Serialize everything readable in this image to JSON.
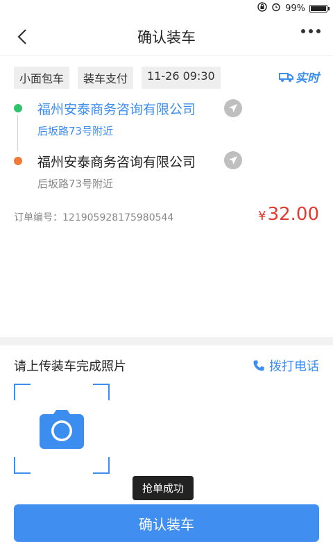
{
  "status_bar": {
    "battery_text": "99%",
    "battery_level": 0.99
  },
  "header": {
    "title": "确认装车"
  },
  "order": {
    "tags": [
      "小面包车",
      "装车支付",
      "11-26 09:30"
    ],
    "realtime_label": "实时",
    "from": {
      "name": "福州安泰商务咨询有限公司",
      "address": "后坂路73号附近"
    },
    "to": {
      "name": "福州安泰商务咨询有限公司",
      "address": "后坂路73号附近"
    },
    "order_number_label": "订单编号：",
    "order_number": "121905928175980544",
    "currency": "¥",
    "price": "32.00"
  },
  "upload": {
    "title": "请上传装车完成照片",
    "call_label": "拨打电话"
  },
  "toast": "抢单成功",
  "confirm_button": "确认装车",
  "colors": {
    "accent": "#3b8df0",
    "price": "#e23b2f",
    "from_dot": "#2fc46b",
    "to_dot": "#f07a3a"
  }
}
